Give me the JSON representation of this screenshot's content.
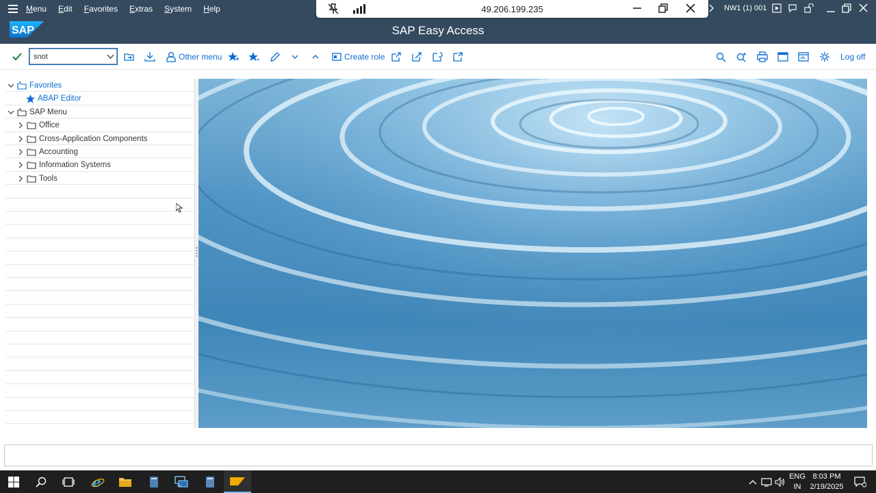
{
  "menubar": {
    "items": [
      "Menu",
      "Edit",
      "Favorites",
      "Extras",
      "System",
      "Help"
    ]
  },
  "remote_session": {
    "ip": "49.206.199.235"
  },
  "system_info": "NW1 (1) 001",
  "app": {
    "logo_text": "SAP",
    "title": "SAP Easy Access"
  },
  "toolbar": {
    "command_value": "snot",
    "other_menu_label": "Other menu",
    "create_role_label": "Create role",
    "log_off_label": "Log off"
  },
  "tree": {
    "nodes": [
      {
        "label": "Favorites",
        "level": 0,
        "expanded": true,
        "icon": "folder-role-icon"
      },
      {
        "label": "ABAP Editor",
        "level": 1,
        "icon": "star-icon"
      },
      {
        "label": "SAP Menu",
        "level": 0,
        "expanded": true,
        "icon": "folder-role-icon"
      },
      {
        "label": "Office",
        "level": 1,
        "expanded": false,
        "icon": "folder-icon"
      },
      {
        "label": "Cross-Application Components",
        "level": 1,
        "expanded": false,
        "icon": "folder-icon"
      },
      {
        "label": "Accounting",
        "level": 1,
        "expanded": false,
        "icon": "folder-icon"
      },
      {
        "label": "Information Systems",
        "level": 1,
        "expanded": false,
        "icon": "folder-icon"
      },
      {
        "label": "Tools",
        "level": 1,
        "expanded": false,
        "icon": "folder-icon"
      }
    ]
  },
  "taskbar": {
    "lang_top": "ENG",
    "lang_bottom": "IN",
    "time": "8:03 PM",
    "date": "2/19/2025"
  },
  "colors": {
    "shell": "#354a5f",
    "accent": "#0a6ed1",
    "toolbar_icon": "#0a6ed1",
    "check": "#107e3e"
  }
}
